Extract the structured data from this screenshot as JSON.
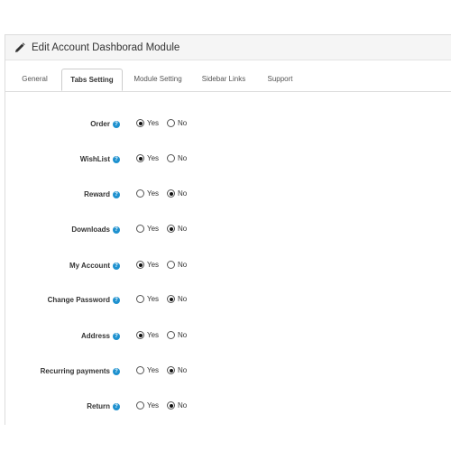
{
  "panel": {
    "title": "Edit Account Dashborad Module",
    "icon": "pencil-icon"
  },
  "tabs": [
    {
      "label": "General",
      "active": false
    },
    {
      "label": "Tabs Setting",
      "active": true
    },
    {
      "label": "Module Setting",
      "active": false
    },
    {
      "label": "Sidebar Links",
      "active": false
    },
    {
      "label": "Support",
      "active": false
    }
  ],
  "options": {
    "yes": "Yes",
    "no": "No",
    "help_glyph": "?"
  },
  "fields": [
    {
      "label": "Order",
      "value": "yes"
    },
    {
      "label": "WishList",
      "value": "yes"
    },
    {
      "label": "Reward",
      "value": "no"
    },
    {
      "label": "Downloads",
      "value": "no"
    },
    {
      "label": "My Account",
      "value": "yes"
    },
    {
      "label": "Change Password",
      "value": "no"
    },
    {
      "label": "Address",
      "value": "yes"
    },
    {
      "label": "Recurring payments",
      "value": "no"
    },
    {
      "label": "Return",
      "value": "no"
    }
  ],
  "colors": {
    "help_icon": "#1e91cf",
    "heading_bg": "#f5f5f5"
  }
}
